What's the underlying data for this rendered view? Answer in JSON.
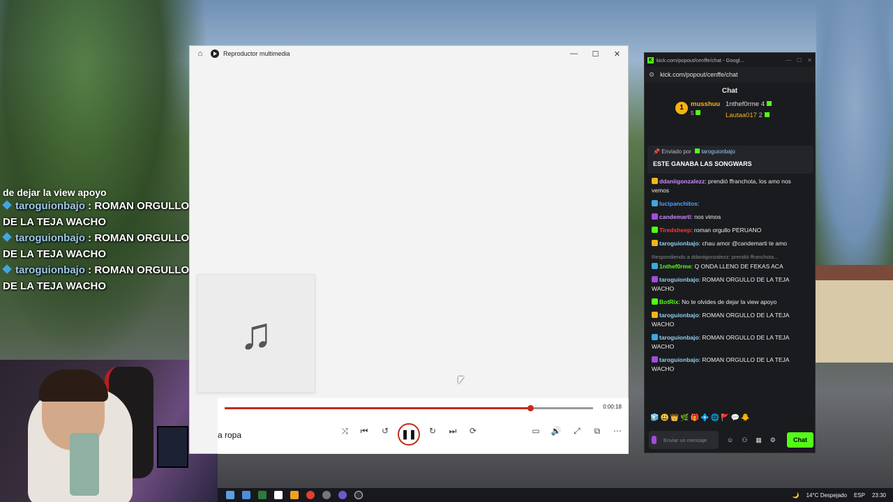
{
  "overlay": {
    "top_line": "de dejar la view apoyo",
    "lines": [
      {
        "user": "taroguionbajo",
        "sep": " : ",
        "text": "ROMAN ORGULLO DE LA TEJA WACHO"
      },
      {
        "user": "taroguionbajo",
        "sep": " : ",
        "text": "ROMAN ORGULLO DE LA TEJA WACHO"
      },
      {
        "user": "taroguionbajo",
        "sep": " : ",
        "text": "ROMAN ORGULLO DE LA TEJA WACHO"
      }
    ]
  },
  "player": {
    "title": "Reproductor multimedia",
    "home_icon": "⌂",
    "minimize": "—",
    "maximize": "☐",
    "close": "✕",
    "art_icon": "♫",
    "time": "0:00:18",
    "progress": 0.83,
    "track": "a ropa",
    "controls": {
      "shuffle": "⤨",
      "prev": "⏮",
      "back10": "↺",
      "pause": "❚❚",
      "fwd30": "↻",
      "next": "⏭",
      "repeat": "⟳",
      "miniplayer": "▭",
      "volume": "🔊",
      "fullscreen": "⤢",
      "cast": "⧉",
      "more": "⋯"
    }
  },
  "chat": {
    "window_title": "kick.com/popout/cenffe/chat - Googl...",
    "url": "kick.com/popout/cenffe/chat",
    "header": "Chat",
    "leaderboard": [
      {
        "rank": "1",
        "user": "musshuu",
        "count": "5"
      },
      {
        "user": "1nthef0rme",
        "count": "4"
      },
      {
        "user": "Lautaa017",
        "count": "2"
      }
    ],
    "pinned": {
      "by_label": "Enviado por",
      "by_user": "taroguionbajo",
      "message": "ESTE GANABA LAS SONGWARS"
    },
    "messages": [
      {
        "user": "ddaniigonzalezz",
        "color": "#c98bff",
        "text": ": prendió ffranchota, los amo nos vemos"
      },
      {
        "user": "lucipanchitos",
        "color": "#4da3ff",
        "text": ":"
      },
      {
        "user": "candemarti",
        "color": "#c98bff",
        "text": ": nos vimos"
      },
      {
        "user": "Tiredsheep",
        "color": "#ff3b3b",
        "text": ": roman orgullo PERUANO"
      },
      {
        "user": "taroguionbajo",
        "color": "#8fd0f0",
        "text": ": chau amor @candemarti te amo"
      },
      {
        "reply": "Respondiendo a ddaniigonzalezz: prendió ffranchota...",
        "user": "1nthef0rme",
        "color": "#53fc18",
        "text": ": Q ONDA LLENO DE FEKAS ACA"
      },
      {
        "user": "taroguionbajo",
        "color": "#8fd0f0",
        "text": ": ROMAN ORGULLO DE LA TEJA WACHO"
      },
      {
        "user": "BotRix",
        "color": "#53fc18",
        "text": ": No te olvides de dejar la view apoyo"
      },
      {
        "user": "taroguionbajo",
        "color": "#8fd0f0",
        "text": ": ROMAN ORGULLO DE LA TEJA WACHO"
      },
      {
        "user": "taroguionbajo",
        "color": "#8fd0f0",
        "text": ": ROMAN ORGULLO DE LA TEJA WACHO"
      },
      {
        "user": "taroguionbajo",
        "color": "#8fd0f0",
        "text": ": ROMAN ORGULLO DE LA TEJA WACHO"
      }
    ],
    "input_placeholder": "Enviar un mensaje",
    "send_label": "Chat"
  },
  "taskbar": {
    "weather": "14°C Despejado",
    "lang": "ESP",
    "time": "23:30"
  }
}
